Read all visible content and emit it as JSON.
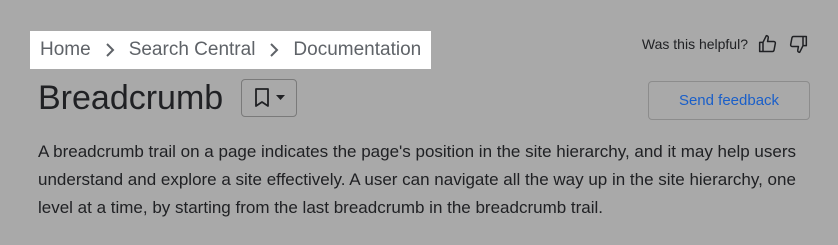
{
  "breadcrumb": {
    "items": [
      "Home",
      "Search Central",
      "Documentation"
    ]
  },
  "feedback": {
    "question": "Was this helpful?",
    "thumbs_up_icon": "thumb-up-icon",
    "thumbs_down_icon": "thumb-down-icon"
  },
  "page": {
    "title": "Breadcrumb",
    "bookmark_icon": "bookmark-icon",
    "send_feedback_label": "Send feedback",
    "description": "A breadcrumb trail on a page indicates the page's position in the site hierarchy, and it may help users understand and explore a site effectively. A user can navigate all the way up in the site hierarchy, one level at a time, by starting from the last breadcrumb in the breadcrumb trail."
  },
  "colors": {
    "background": "#a9a9a9",
    "highlight": "#ffffff",
    "link": "#1a5fc9"
  }
}
